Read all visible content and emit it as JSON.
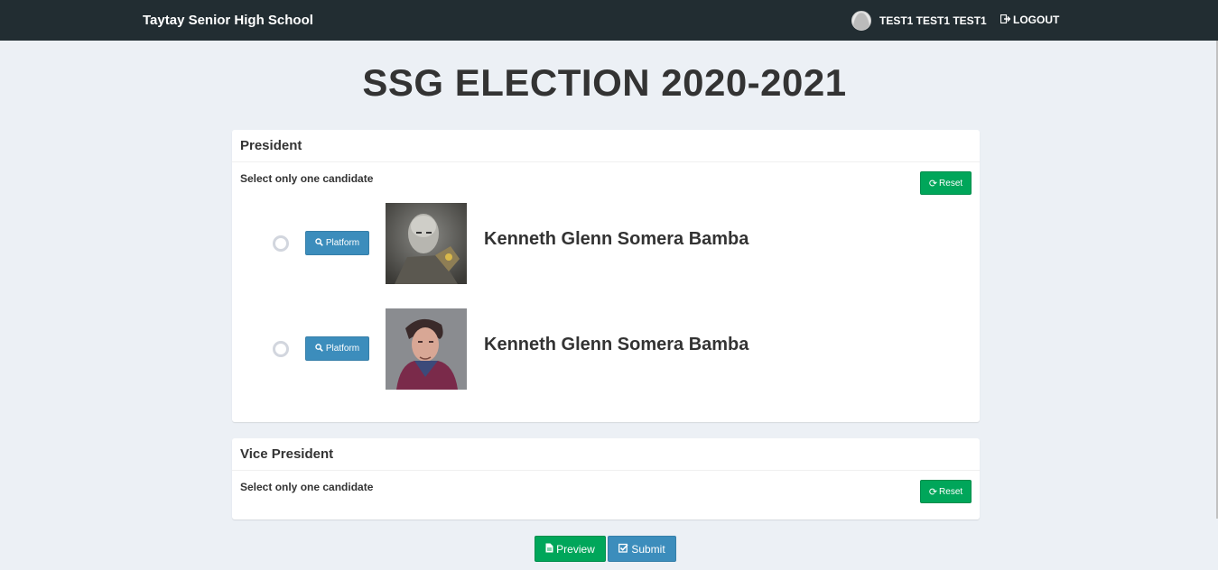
{
  "navbar": {
    "brand": "Taytay Senior High School",
    "user_name": "TEST1 TEST1 TEST1",
    "logout_label": "LOGOUT"
  },
  "page_title": "SSG ELECTION 2020-2021",
  "positions": [
    {
      "title": "President",
      "instruction": "Select only one candidate",
      "reset_label": "Reset",
      "candidates": [
        {
          "name": "Kenneth Glenn Somera Bamba",
          "platform_label": "Platform"
        },
        {
          "name": "Kenneth Glenn Somera Bamba",
          "platform_label": "Platform"
        }
      ]
    },
    {
      "title": "Vice President",
      "instruction": "Select only one candidate",
      "reset_label": "Reset",
      "candidates": []
    }
  ],
  "actions": {
    "preview_label": "Preview",
    "submit_label": "Submit"
  },
  "colors": {
    "navbar": "#222d32",
    "background": "#ecf0f5",
    "success": "#00a65a",
    "primary": "#3c8dbc"
  },
  "icons": {
    "logout": "sign-out-icon",
    "reset": "refresh-icon",
    "platform": "search-icon",
    "preview": "file-icon",
    "submit": "check-square-icon"
  }
}
